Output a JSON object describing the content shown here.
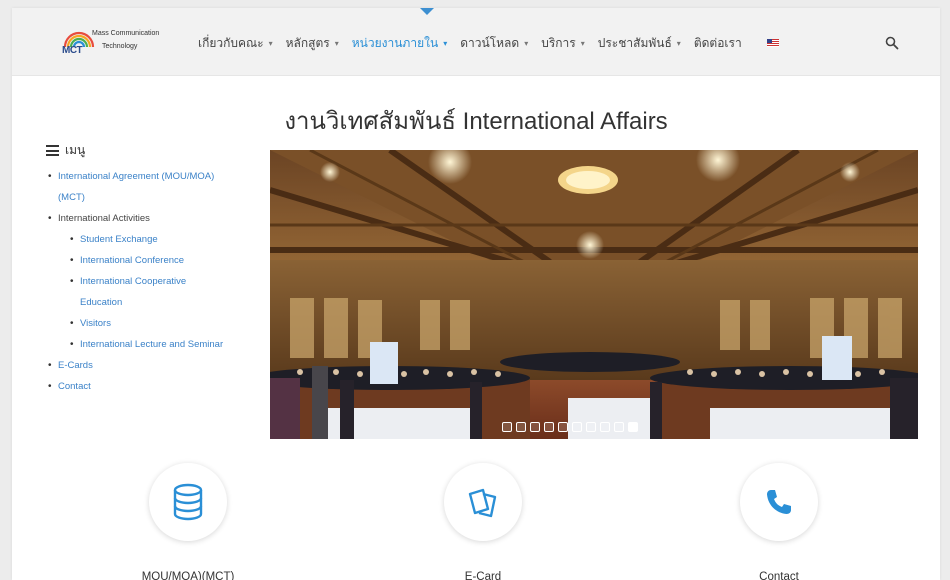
{
  "nav": {
    "logo": {
      "line1": "Mass Communication",
      "line2": "Technology",
      "mark": "MCT"
    },
    "items": [
      {
        "label": "เกี่ยวกับคณะ",
        "caret": "▾"
      },
      {
        "label": "หลักสูตร",
        "caret": "▾"
      },
      {
        "label": "หน่วยงานภายใน",
        "caret": "▾"
      },
      {
        "label": "ดาวน์โหลด",
        "caret": "▾"
      },
      {
        "label": "บริการ",
        "caret": "▾"
      },
      {
        "label": "ประชาสัมพันธ์",
        "caret": "▾"
      },
      {
        "label": "ติดต่อเรา"
      }
    ],
    "active_index": 2,
    "accent_color": "#2a8fd6",
    "language_icon": "us-flag-icon",
    "search_icon": "search-icon"
  },
  "page": {
    "title": "งานวิเทศสัมพันธ์ International Affairs"
  },
  "sidebar": {
    "heading": "เมนู",
    "items": [
      {
        "label": "International Agreement (MOU/MOA)",
        "label2": "(MCT)",
        "link": true
      },
      {
        "label": "International Activities",
        "link": false
      },
      {
        "label": "Student Exchange",
        "link": true,
        "sub": true
      },
      {
        "label": "International Conference",
        "link": true,
        "sub": true
      },
      {
        "label": "International Cooperative",
        "label2": "Education",
        "link": true,
        "sub": true
      },
      {
        "label": "Visitors",
        "link": true,
        "sub": true
      },
      {
        "label": "International Lecture and Seminar",
        "link": true,
        "sub": true
      },
      {
        "label": "E-Cards",
        "link": true
      },
      {
        "label": "Contact",
        "link": true
      }
    ]
  },
  "carousel": {
    "slide_count": 10,
    "active_index": 9
  },
  "features": [
    {
      "label": "MOU/MOA)(MCT)",
      "icon": "database-icon"
    },
    {
      "label": "E-Card",
      "icon": "cards-icon"
    },
    {
      "label": "Contact",
      "icon": "phone-icon"
    }
  ],
  "colors": {
    "link": "#3b82c8",
    "icon_blue": "#2a8fd6"
  }
}
